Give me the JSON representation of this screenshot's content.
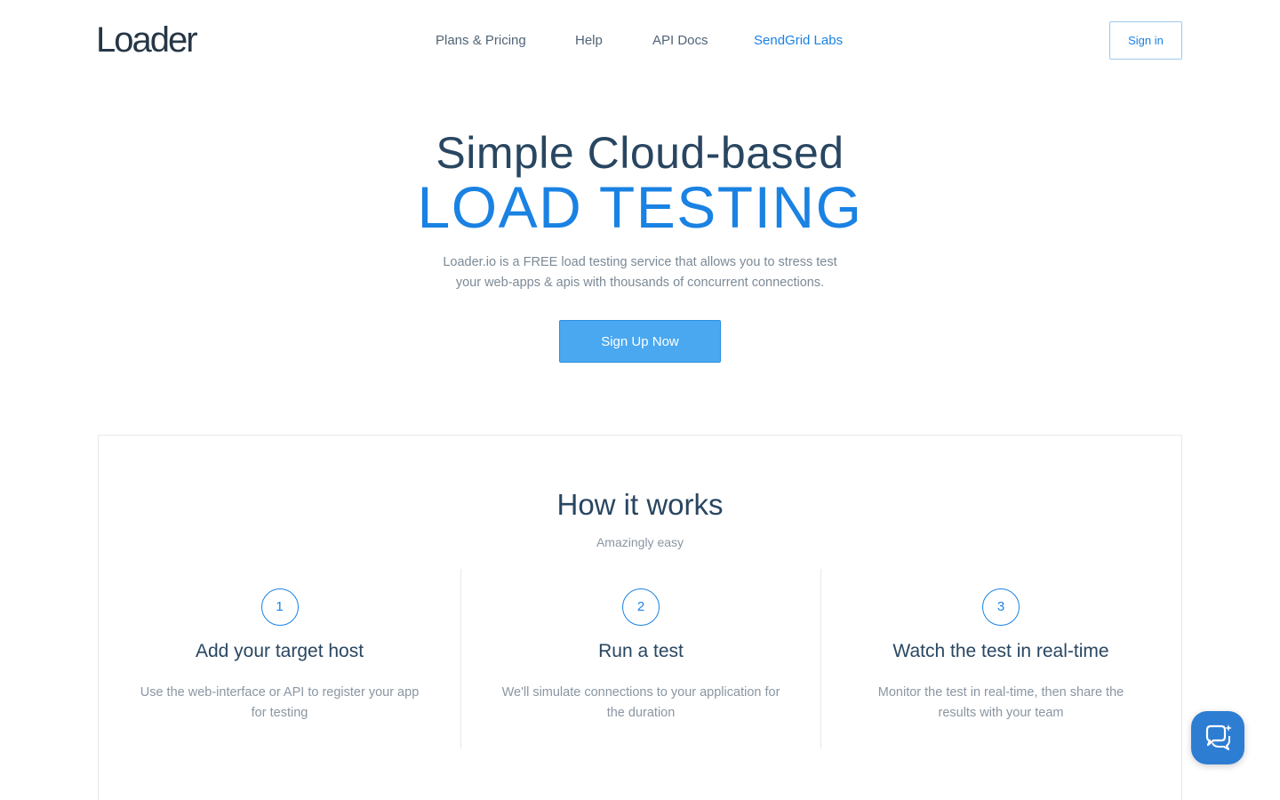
{
  "header": {
    "logo": "Loader",
    "nav": {
      "plans": "Plans & Pricing",
      "help": "Help",
      "api": "API Docs",
      "labs": "SendGrid Labs"
    },
    "signin": "Sign in"
  },
  "hero": {
    "title": "Simple Cloud-based",
    "subtitle": "LOAD TESTING",
    "description": "Loader.io is a FREE load testing service that allows you to stress test your web-apps & apis with thousands of concurrent connections.",
    "cta": "Sign Up Now"
  },
  "how": {
    "title": "How it works",
    "subtitle": "Amazingly easy",
    "steps": [
      {
        "num": "1",
        "title": "Add your target host",
        "desc": "Use the web-interface or API to register your app for testing"
      },
      {
        "num": "2",
        "title": "Run a test",
        "desc": "We'll simulate connections to your application for the duration"
      },
      {
        "num": "3",
        "title": "Watch the test in real-time",
        "desc": "Monitor the test in real-time, then share the results with your team"
      }
    ]
  },
  "chat_icon": "chat-bubble-icon",
  "colors": {
    "accent": "#1a82e2",
    "button": "#4aa8f0",
    "text": "#294661",
    "muted": "#8a96a2",
    "chat": "#2d7dd2"
  }
}
